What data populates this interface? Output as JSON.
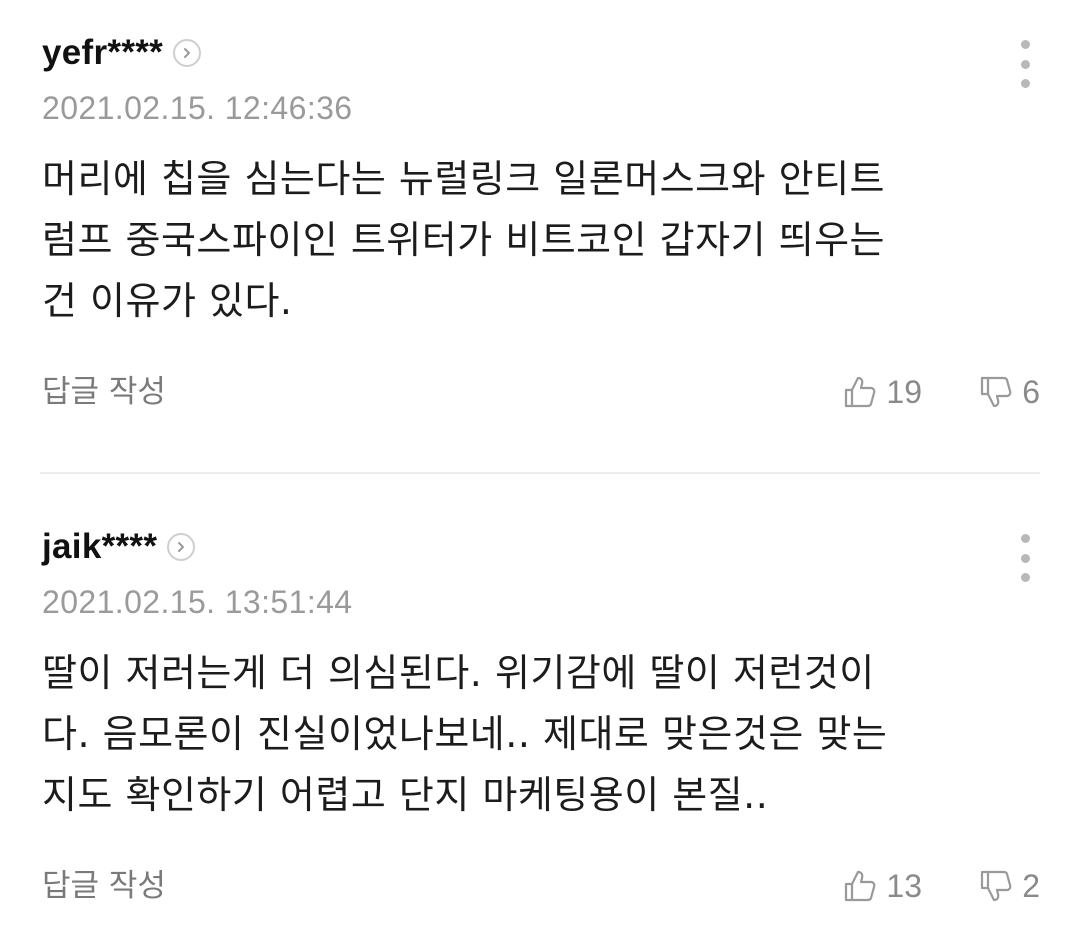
{
  "comments": [
    {
      "username": "yefr****",
      "timestamp": "2021.02.15. 12:46:36",
      "body_lines": [
        "머리에 칩을 심는다는 뉴럴링크 일론머스크와 안티트",
        "럼프 중국스파이인 트위터가 비트코인 갑자기 띄우는",
        "건 이유가 있다."
      ],
      "reply_label": "답글 작성",
      "likes": "19",
      "dislikes": "6"
    },
    {
      "username": "jaik****",
      "timestamp": "2021.02.15. 13:51:44",
      "body_lines": [
        "딸이 저러는게 더 의심된다. 위기감에 딸이 저런것이",
        "다. 음모론이 진실이었나보네.. 제대로 맞은것은 맞는",
        "지도 확인하기 어렵고 단지 마케팅용이 본질.."
      ],
      "reply_label": "답글 작성",
      "likes": "13",
      "dislikes": "2"
    }
  ],
  "icons": {
    "profile": "chevron-right-circle-icon",
    "more": "vertical-ellipsis-icon",
    "like": "thumbs-up-icon",
    "dislike": "thumbs-down-icon"
  },
  "colors": {
    "text": "#1c1c1c",
    "meta": "#9a9a9a",
    "icon": "#9a9a9a",
    "divider": "#ececec"
  }
}
